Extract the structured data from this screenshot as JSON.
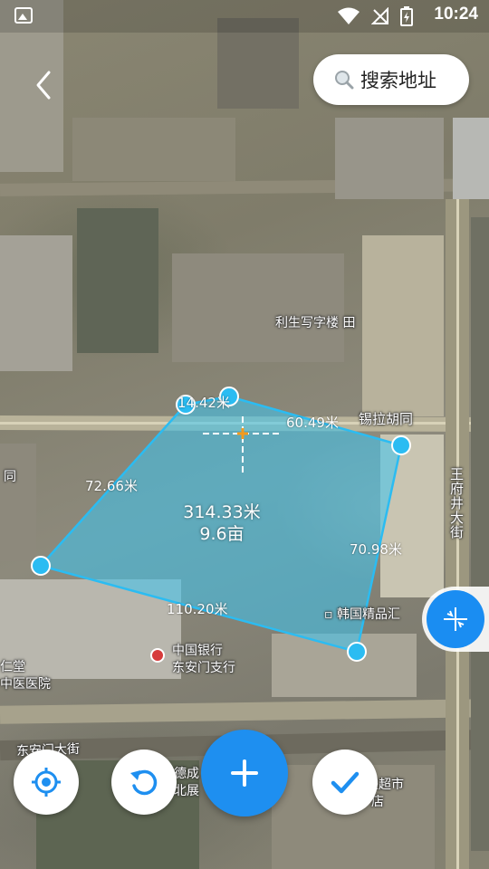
{
  "status_bar": {
    "time": "10:24",
    "icons": [
      "image-icon",
      "wifi-icon",
      "no-signal-icon",
      "battery-charging-icon"
    ]
  },
  "header": {
    "back_icon": "chevron-left-icon",
    "search": {
      "icon": "search-icon",
      "label": "搜索地址"
    }
  },
  "map_labels": {
    "building": "利生写字楼",
    "building_suffix": "田",
    "alley": "锡拉胡同",
    "street_vertical": "王府井大街",
    "shop": "韩国精品汇",
    "bank_line1": "中国银行",
    "bank_line2": "东安门支行",
    "hospital_line1": "仁堂",
    "hospital_line2": "中医医院",
    "hutong_left": "同",
    "street_bottom": "东安门大街",
    "market_line1": "德成",
    "market_line2": "北展",
    "supermarket_line1": "联超市",
    "supermarket_line2": "店"
  },
  "measurement": {
    "segments": [
      "14.42米",
      "60.49米",
      "70.98米",
      "110.20米",
      "72.66米"
    ],
    "perimeter": "314.33米",
    "area": "9.6亩"
  },
  "controls": {
    "side_tool_icon": "crosshair-shrink-icon",
    "locate_icon": "locate-icon",
    "undo_icon": "undo-icon",
    "add_icon": "plus-icon",
    "confirm_icon": "check-icon"
  },
  "colors": {
    "accent": "#1e8ff0",
    "polygon_fill": "#3cc4f0",
    "polygon_stroke": "#2bbcf2"
  }
}
